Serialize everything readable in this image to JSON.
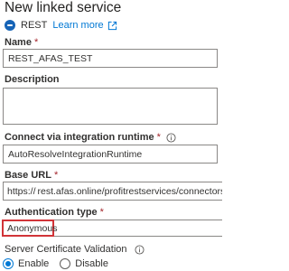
{
  "header": {
    "title": "New linked service",
    "service_type": "REST",
    "learn_more": "Learn more",
    "service_icon": "rest-globe-icon",
    "external_icon": "external-link-icon"
  },
  "form": {
    "name": {
      "label": "Name",
      "required": "*",
      "value": "REST_AFAS_TEST"
    },
    "description": {
      "label": "Description",
      "value": ""
    },
    "runtime": {
      "label": "Connect via integration runtime",
      "required": "*",
      "value": "AutoResolveIntegrationRuntime"
    },
    "base_url": {
      "label": "Base URL",
      "required": "*",
      "value_prefix": "https://",
      "value_suffix": "rest.afas.online/profitrestservices/connectors/"
    },
    "auth": {
      "label": "Authentication type",
      "required": "*",
      "value": "Anonymous"
    },
    "cert": {
      "label": "Server Certificate Validation",
      "options": [
        "Enable",
        "Disable"
      ],
      "selected": "Enable"
    }
  },
  "colors": {
    "accent": "#0078d4",
    "required": "#a4262c",
    "highlight_border": "#d13438"
  }
}
